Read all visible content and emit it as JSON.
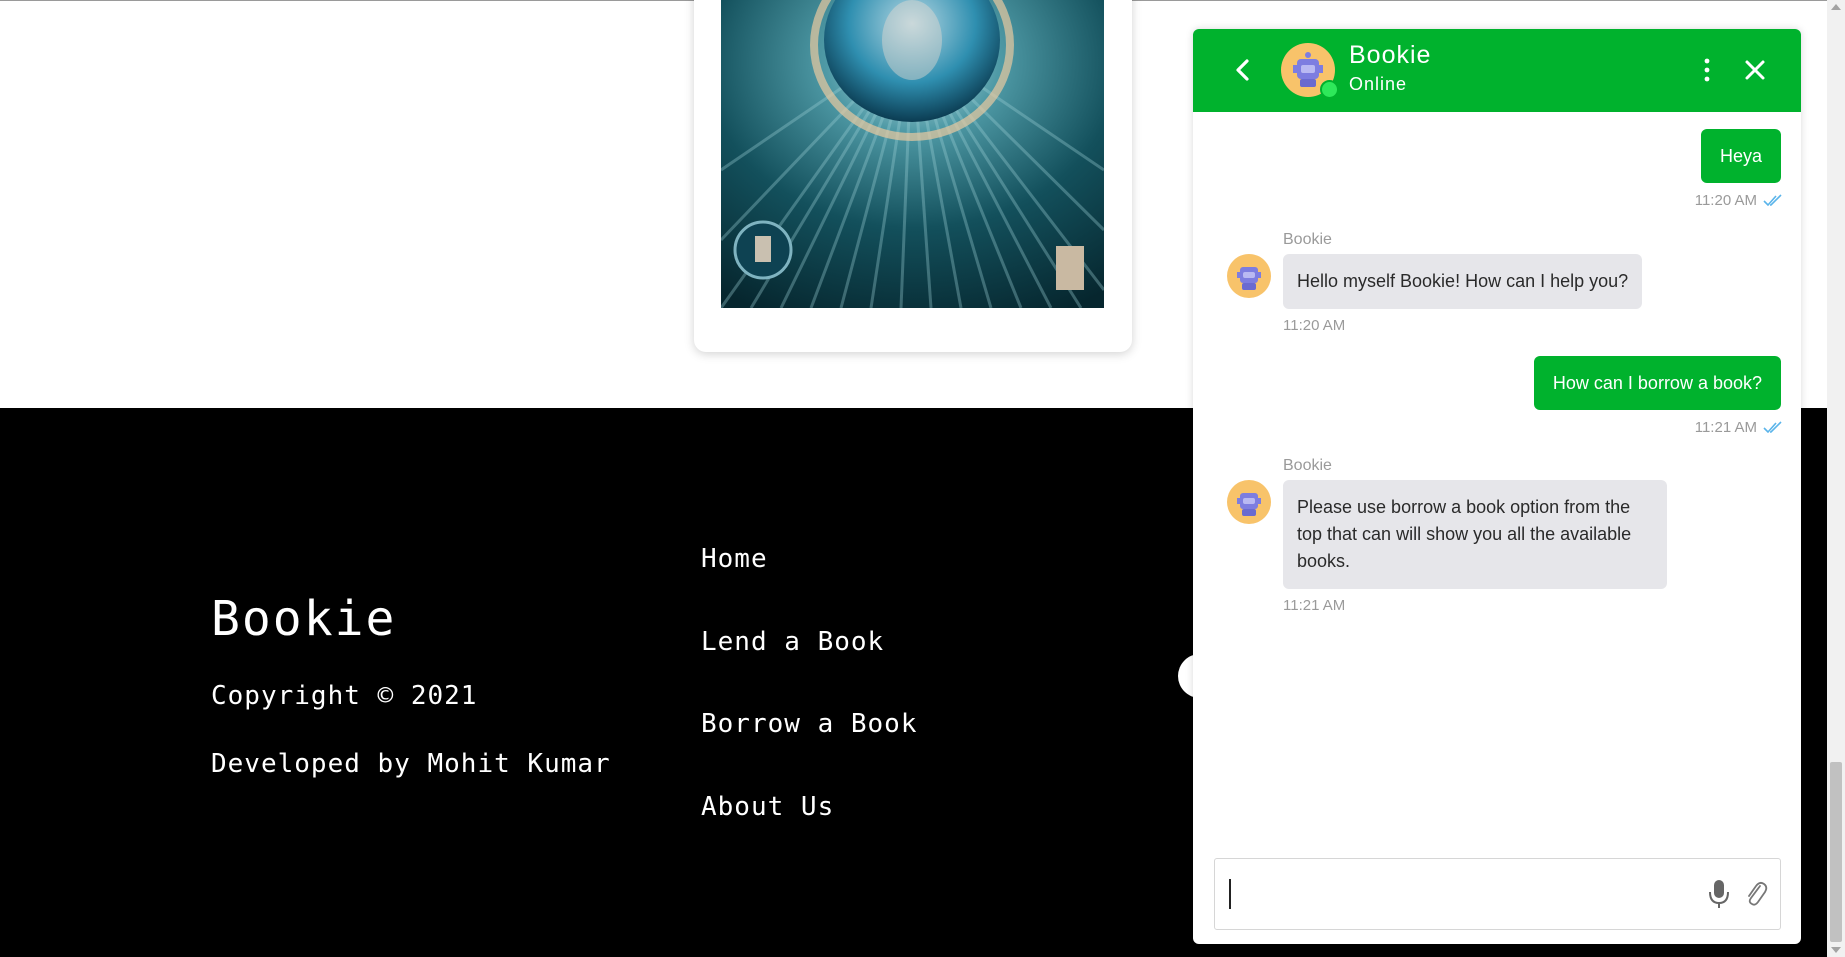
{
  "footer": {
    "brand": "Bookie",
    "copyright": "Copyright © 2021",
    "developer": "Developed by Mohit Kumar",
    "links": [
      "Home",
      "Lend a Book",
      "Borrow a Book",
      "About Us"
    ]
  },
  "chat": {
    "title": "Bookie",
    "status": "Online",
    "messages": [
      {
        "from": "user",
        "text": "Heya",
        "time": "11:20 AM"
      },
      {
        "from": "bot",
        "sender": "Bookie",
        "text": "Hello myself Bookie! How can I help you?",
        "time": "11:20 AM"
      },
      {
        "from": "user",
        "text": "How can I borrow a book?",
        "time": "11:21 AM"
      },
      {
        "from": "bot",
        "sender": "Bookie",
        "text": "Please use borrow a book option from the top that can will show you all the available books.",
        "time": "11:21 AM"
      }
    ],
    "input_value": "",
    "accent": "#00b22d",
    "icons": [
      "back-arrow-icon",
      "more-vertical-icon",
      "close-icon",
      "microphone-icon",
      "paperclip-icon"
    ]
  }
}
